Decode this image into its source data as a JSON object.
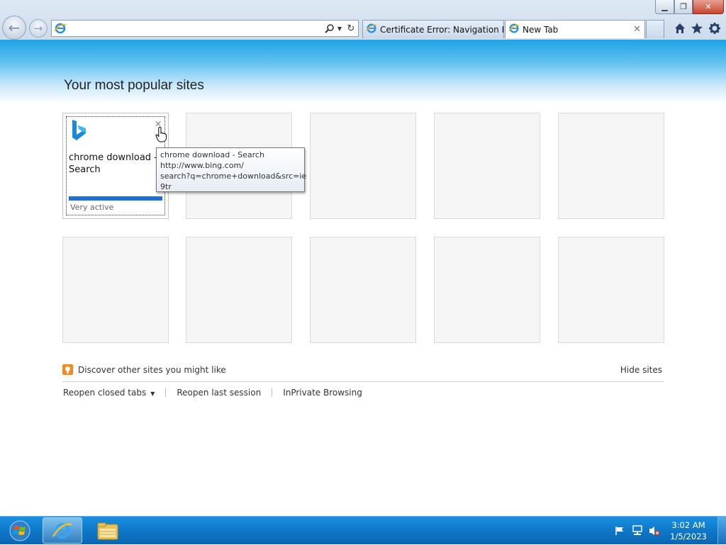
{
  "window": {
    "minimize_glyph": "▁",
    "maximize_glyph": "❐",
    "close_glyph": "✕"
  },
  "address_bar": {
    "value": "",
    "placeholder": ""
  },
  "tabs": [
    {
      "label": "Certificate Error: Navigation Bl...",
      "icon": "ie-page-icon",
      "active": false
    },
    {
      "label": "New Tab",
      "icon": "ie-page-icon",
      "active": true,
      "close": "✕"
    }
  ],
  "content": {
    "heading": "Your most popular sites",
    "top_site": {
      "title": "chrome download - Search",
      "activity": "Very active",
      "activity_level": 1.0,
      "close": "✕"
    },
    "tooltip": {
      "line1": "chrome download - Search",
      "line2": "http://www.bing.com/",
      "line3": "search?q=chrome+download&src=ie",
      "line4": "9tr"
    },
    "discover": "Discover other sites you might like",
    "hide_sites": "Hide sites",
    "links": {
      "reopen_closed": "Reopen closed tabs",
      "reopen_last": "Reopen last session",
      "inprivate": "InPrivate Browsing"
    }
  },
  "taskbar": {
    "time": "3:02 AM",
    "date": "1/5/2023"
  },
  "colors": {
    "banner_top": "#1ea3e6",
    "activity_bar": "#1f6fd1",
    "discover_icon": "#f28a1e",
    "taskbar": "#0f78c8"
  }
}
